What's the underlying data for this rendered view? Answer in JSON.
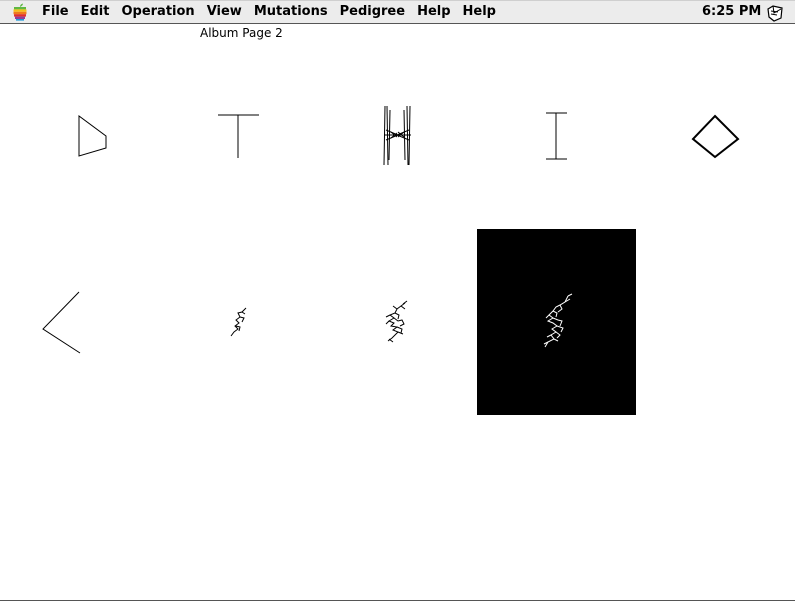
{
  "menubar": {
    "items": [
      "File",
      "Edit",
      "Operation",
      "View",
      "Mutations",
      "Pedigree",
      "Help",
      "Help"
    ],
    "clock": "6:25 PM",
    "apple_icon": "apple-icon",
    "app_icon": "application-switcher-icon"
  },
  "window": {
    "title": "Album Page 2"
  },
  "album": {
    "biomorphs": [
      {
        "shape": "triangle",
        "selected": false
      },
      {
        "shape": "tee",
        "selected": false
      },
      {
        "shape": "tie-fighter",
        "selected": false
      },
      {
        "shape": "i-beam",
        "selected": false
      },
      {
        "shape": "diamond",
        "selected": false
      },
      {
        "shape": "chevron",
        "selected": false
      },
      {
        "shape": "squiggle-small",
        "selected": false
      },
      {
        "shape": "squiggle-medium",
        "selected": false
      },
      {
        "shape": "squiggle-large",
        "selected": true
      }
    ],
    "colors": {
      "stroke": "#000000",
      "selected_bg": "#000000",
      "selected_stroke": "#ffffff"
    }
  }
}
